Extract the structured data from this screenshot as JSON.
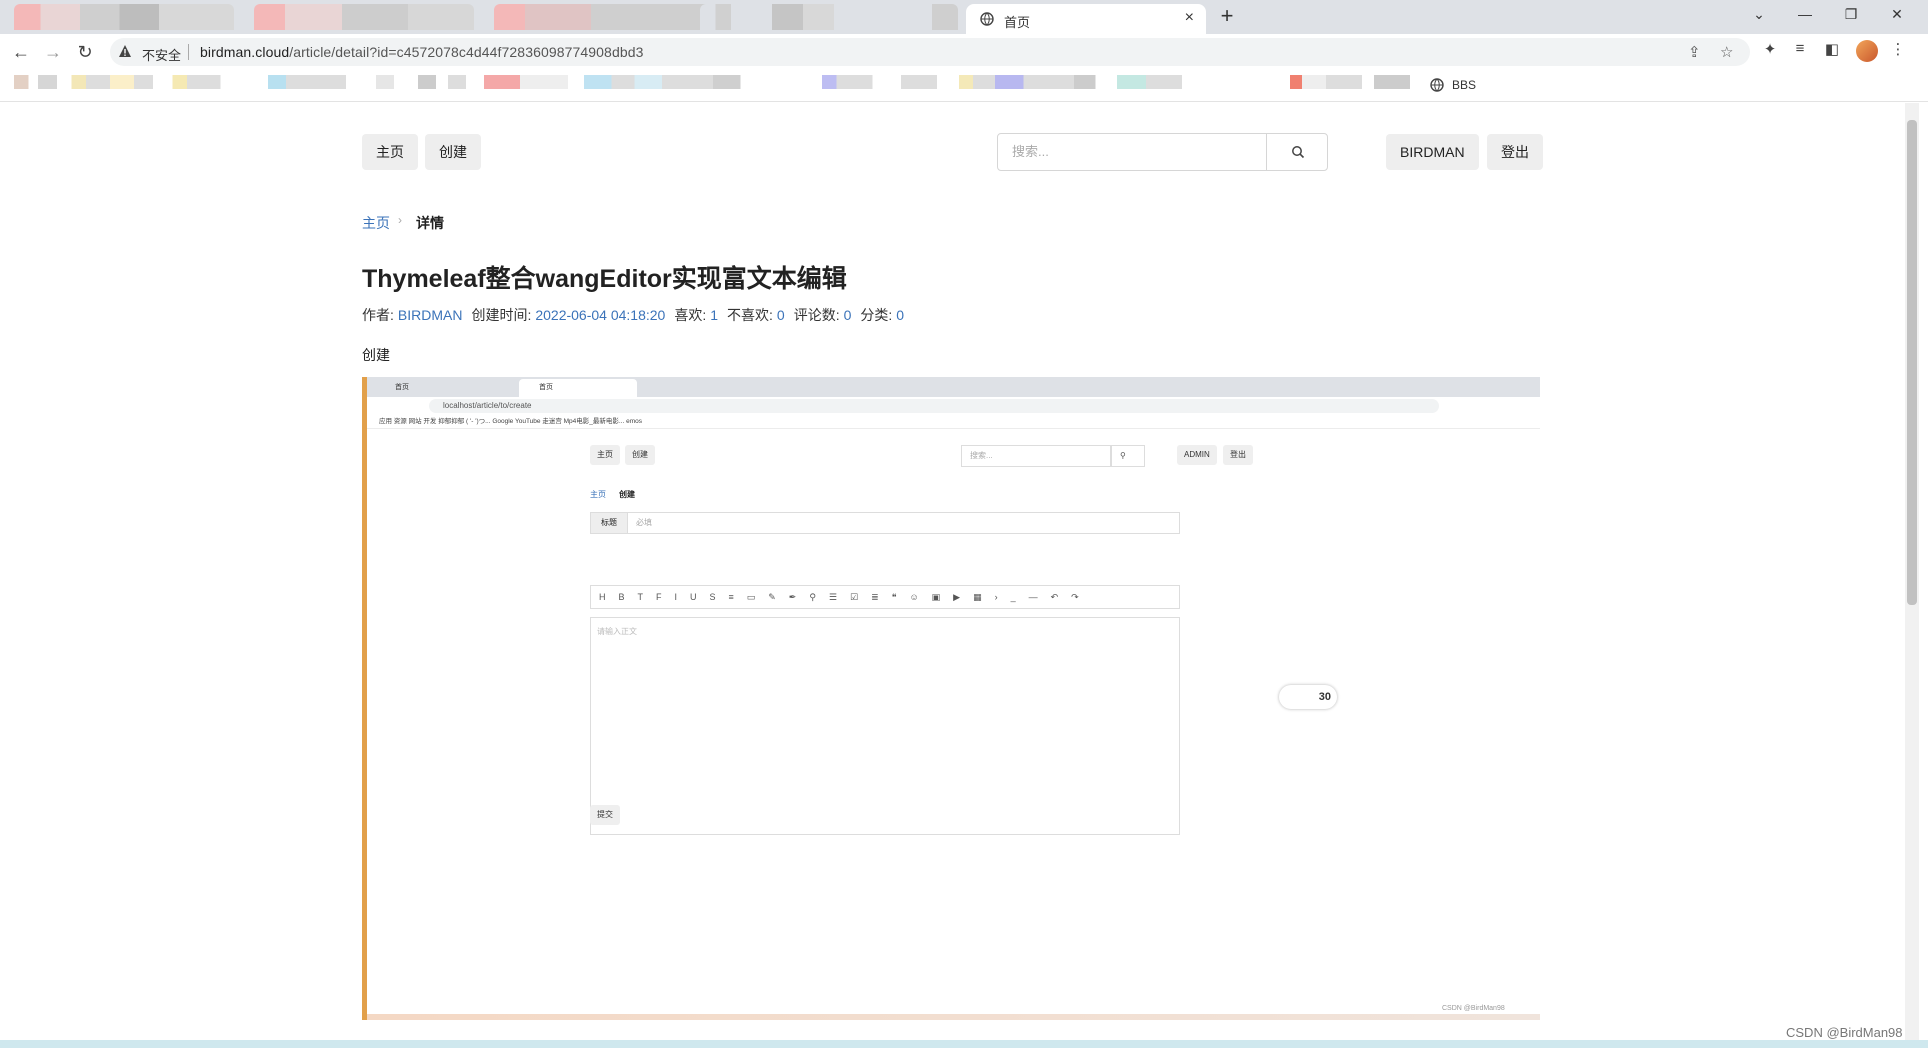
{
  "browser": {
    "active_tab_title": "首页",
    "insecure_label": "不安全",
    "url_host": "birdman.cloud",
    "url_path": "/article/detail?id=c4572078c4d44f72836098774908dbd3",
    "bookmark_visible": "BBS"
  },
  "nav": {
    "home": "主页",
    "create": "创建",
    "search_placeholder": "搜索...",
    "user": "BIRDMAN",
    "logout": "登出"
  },
  "breadcrumb": {
    "home": "主页",
    "current": "详情"
  },
  "article": {
    "title": "Thymeleaf整合wangEditor实现富文本编辑",
    "author_label": "作者:",
    "author": "BIRDMAN",
    "created_label": "创建时间:",
    "created": "2022-06-04 04:18:20",
    "likes_label": "喜欢:",
    "likes": "1",
    "dislikes_label": "不喜欢:",
    "dislikes": "0",
    "comments_label": "评论数:",
    "comments": "0",
    "category_label": "分类:",
    "category": "0",
    "body_text": "创建"
  },
  "embedded": {
    "tab1": "首页",
    "tab2": "首页",
    "url": "localhost/article/to/create",
    "bookmarks": "应用   资源   网站   开发   抑郁抑郁 ( '- ')つ...   Google   YouTube   走迷宫   Mp4电影_最新电影...   emos",
    "home": "主页",
    "create": "创建",
    "search": "搜索...",
    "admin": "ADMIN",
    "logout": "登出",
    "crumb_home": "主页",
    "crumb_current": "创建",
    "title_label": "标题",
    "title_placeholder": "必填",
    "toolbar": "HBTFIUS≡▭✎✒⚲☰☑≣❝☺▣▶▦›_—↶↷",
    "editor_placeholder": "请输入正文",
    "submit": "提交",
    "speed": "30",
    "watermark": "CSDN @BirdMan98"
  },
  "watermark": "CSDN @BirdMan98"
}
